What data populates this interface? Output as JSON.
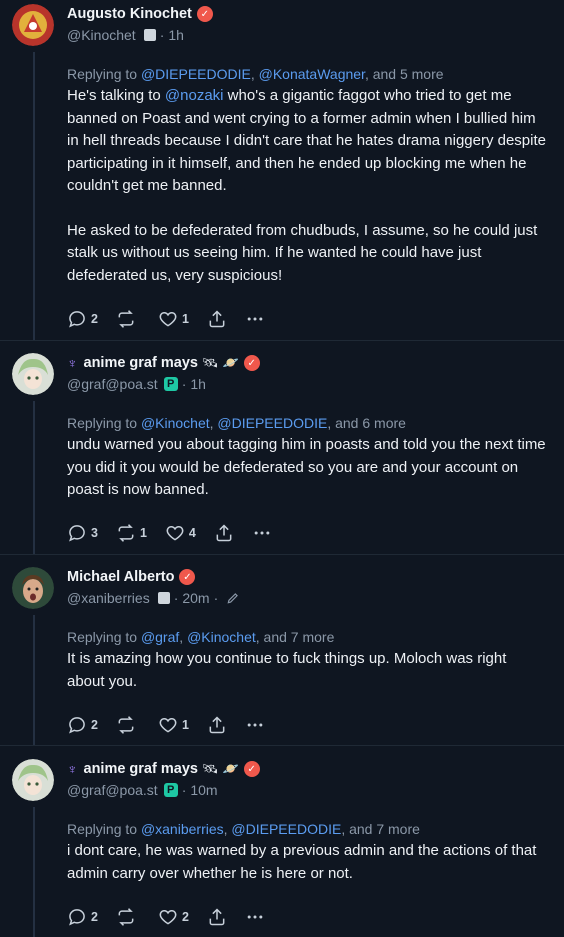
{
  "posts": [
    {
      "display_name": "Augusto Kinochet",
      "handle": "@Kinochet",
      "time": "1h",
      "replying_prefix": "Replying to ",
      "replying_mentions": [
        "@DIEPEEDODIE",
        "@KonataWagner"
      ],
      "replying_more": "and 5 more",
      "body_paragraphs": [
        "He's talking to @nozaki who's a gigantic faggot who tried to get me banned on Poast and went crying to a former admin when I bullied him in hell threads because I didn't care that he hates drama niggery despite participating in it himself, and then he ended up blocking me when he couldn't get me banned.",
        "He asked to be defederated from chudbuds, I assume, so he could just stalk us without us seeing him. If he wanted he could have just defederated us, very suspicious!"
      ],
      "body_mention": "@nozaki",
      "counts": {
        "replies": "2",
        "reposts": "",
        "likes": "1"
      }
    },
    {
      "display_name": "anime graf mays",
      "handle": "@graf@poa.st",
      "time": "1h",
      "replying_prefix": "Replying to ",
      "replying_mentions": [
        "@Kinochet",
        "@DIEPEEDODIE"
      ],
      "replying_more": "and 6 more",
      "body_paragraphs": [
        "undu warned you about tagging him in poasts and told you the next time you did it you would be defederated so you are and your account on poast is now banned."
      ],
      "counts": {
        "replies": "3",
        "reposts": "1",
        "likes": "4"
      }
    },
    {
      "display_name": "Michael Alberto",
      "handle": "@xaniberries",
      "time": "20m",
      "replying_prefix": "Replying to ",
      "replying_mentions": [
        "@graf",
        "@Kinochet"
      ],
      "replying_more": "and 7 more",
      "body_paragraphs": [
        "It is amazing how you continue to fuck things up. Moloch was right about you."
      ],
      "counts": {
        "replies": "2",
        "reposts": "",
        "likes": "1"
      }
    },
    {
      "display_name": "anime graf mays",
      "handle": "@graf@poa.st",
      "time": "10m",
      "replying_prefix": "Replying to ",
      "replying_mentions": [
        "@xaniberries",
        "@DIEPEEDODIE"
      ],
      "replying_more": "and 7 more",
      "body_paragraphs": [
        "i dont care, he was warned by a previous admin and the actions of that admin carry over whether he is here or not."
      ],
      "counts": {
        "replies": "2",
        "reposts": "",
        "likes": "2"
      }
    }
  ],
  "separator": "·",
  "instance_badge_letter": "P",
  "colors": {
    "background": "#0f1621",
    "mention": "#5b9cf0",
    "verified": "#f0584c",
    "muted": "#8b98a8"
  }
}
